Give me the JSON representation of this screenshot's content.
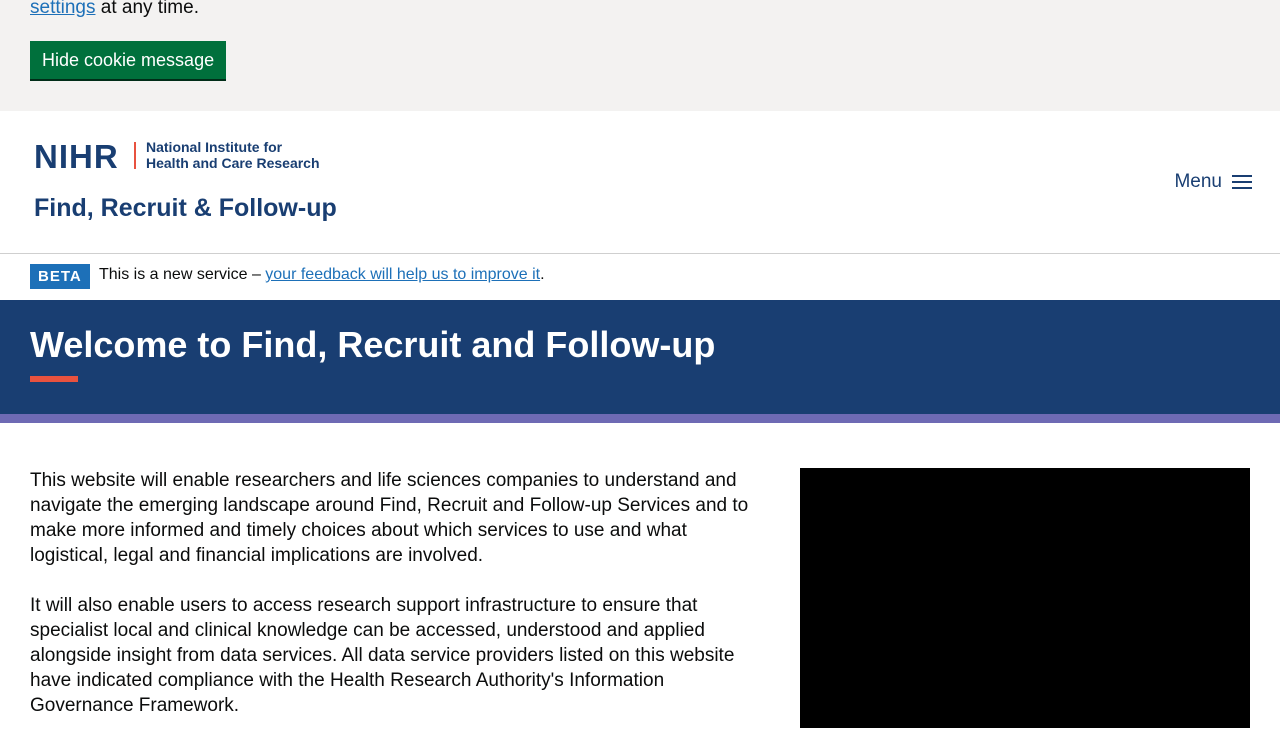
{
  "cookie": {
    "link_text": "settings",
    "text_after": " at any time.",
    "hide_button": "Hide cookie message"
  },
  "header": {
    "logo_nihr": "NIHR",
    "logo_institute_line1": "National Institute for",
    "logo_institute_line2": "Health and Care Research",
    "service_name": "Find, Recruit & Follow-up",
    "menu_label": "Menu"
  },
  "beta": {
    "tag": "BETA",
    "text_before": "This is a new service – ",
    "link_text": "your feedback will help us to improve it",
    "text_after": "."
  },
  "hero": {
    "title": "Welcome to Find, Recruit and Follow-up"
  },
  "main": {
    "paragraphs": [
      "This website will enable researchers and life sciences companies to understand and navigate the emerging landscape around Find, Recruit and Follow-up Services and to make more informed and timely choices about which services to use and what logistical, legal and financial implications are involved.",
      "It will also enable users to access research support infrastructure to ensure that specialist local and clinical knowledge can be accessed, understood and applied alongside insight from data services. All data service providers listed on this website have indicated compliance with the Health Research Authority's Information Governance Framework."
    ]
  },
  "colors": {
    "brand_navy": "#193e72",
    "accent_coral": "#e8523f",
    "stripe_purple": "#6e6ab4",
    "button_green": "#00703c",
    "link_blue": "#1d70b8"
  },
  "icons": {
    "menu": "hamburger-icon"
  }
}
